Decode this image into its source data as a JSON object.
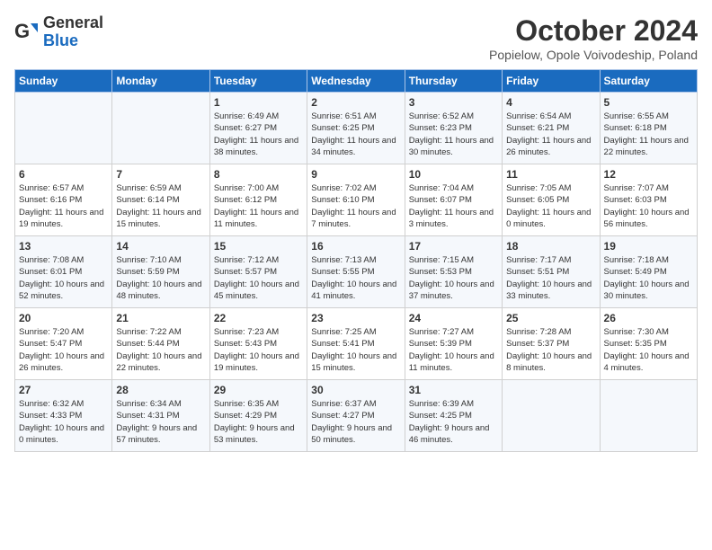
{
  "header": {
    "logo": {
      "general": "General",
      "blue": "Blue"
    },
    "title": "October 2024",
    "location": "Popielow, Opole Voivodeship, Poland"
  },
  "days_of_week": [
    "Sunday",
    "Monday",
    "Tuesday",
    "Wednesday",
    "Thursday",
    "Friday",
    "Saturday"
  ],
  "weeks": [
    [
      {
        "day": "",
        "info": ""
      },
      {
        "day": "",
        "info": ""
      },
      {
        "day": "1",
        "info": "Sunrise: 6:49 AM\nSunset: 6:27 PM\nDaylight: 11 hours\nand 38 minutes."
      },
      {
        "day": "2",
        "info": "Sunrise: 6:51 AM\nSunset: 6:25 PM\nDaylight: 11 hours\nand 34 minutes."
      },
      {
        "day": "3",
        "info": "Sunrise: 6:52 AM\nSunset: 6:23 PM\nDaylight: 11 hours\nand 30 minutes."
      },
      {
        "day": "4",
        "info": "Sunrise: 6:54 AM\nSunset: 6:21 PM\nDaylight: 11 hours\nand 26 minutes."
      },
      {
        "day": "5",
        "info": "Sunrise: 6:55 AM\nSunset: 6:18 PM\nDaylight: 11 hours\nand 22 minutes."
      }
    ],
    [
      {
        "day": "6",
        "info": "Sunrise: 6:57 AM\nSunset: 6:16 PM\nDaylight: 11 hours\nand 19 minutes."
      },
      {
        "day": "7",
        "info": "Sunrise: 6:59 AM\nSunset: 6:14 PM\nDaylight: 11 hours\nand 15 minutes."
      },
      {
        "day": "8",
        "info": "Sunrise: 7:00 AM\nSunset: 6:12 PM\nDaylight: 11 hours\nand 11 minutes."
      },
      {
        "day": "9",
        "info": "Sunrise: 7:02 AM\nSunset: 6:10 PM\nDaylight: 11 hours\nand 7 minutes."
      },
      {
        "day": "10",
        "info": "Sunrise: 7:04 AM\nSunset: 6:07 PM\nDaylight: 11 hours\nand 3 minutes."
      },
      {
        "day": "11",
        "info": "Sunrise: 7:05 AM\nSunset: 6:05 PM\nDaylight: 11 hours\nand 0 minutes."
      },
      {
        "day": "12",
        "info": "Sunrise: 7:07 AM\nSunset: 6:03 PM\nDaylight: 10 hours\nand 56 minutes."
      }
    ],
    [
      {
        "day": "13",
        "info": "Sunrise: 7:08 AM\nSunset: 6:01 PM\nDaylight: 10 hours\nand 52 minutes."
      },
      {
        "day": "14",
        "info": "Sunrise: 7:10 AM\nSunset: 5:59 PM\nDaylight: 10 hours\nand 48 minutes."
      },
      {
        "day": "15",
        "info": "Sunrise: 7:12 AM\nSunset: 5:57 PM\nDaylight: 10 hours\nand 45 minutes."
      },
      {
        "day": "16",
        "info": "Sunrise: 7:13 AM\nSunset: 5:55 PM\nDaylight: 10 hours\nand 41 minutes."
      },
      {
        "day": "17",
        "info": "Sunrise: 7:15 AM\nSunset: 5:53 PM\nDaylight: 10 hours\nand 37 minutes."
      },
      {
        "day": "18",
        "info": "Sunrise: 7:17 AM\nSunset: 5:51 PM\nDaylight: 10 hours\nand 33 minutes."
      },
      {
        "day": "19",
        "info": "Sunrise: 7:18 AM\nSunset: 5:49 PM\nDaylight: 10 hours\nand 30 minutes."
      }
    ],
    [
      {
        "day": "20",
        "info": "Sunrise: 7:20 AM\nSunset: 5:47 PM\nDaylight: 10 hours\nand 26 minutes."
      },
      {
        "day": "21",
        "info": "Sunrise: 7:22 AM\nSunset: 5:44 PM\nDaylight: 10 hours\nand 22 minutes."
      },
      {
        "day": "22",
        "info": "Sunrise: 7:23 AM\nSunset: 5:43 PM\nDaylight: 10 hours\nand 19 minutes."
      },
      {
        "day": "23",
        "info": "Sunrise: 7:25 AM\nSunset: 5:41 PM\nDaylight: 10 hours\nand 15 minutes."
      },
      {
        "day": "24",
        "info": "Sunrise: 7:27 AM\nSunset: 5:39 PM\nDaylight: 10 hours\nand 11 minutes."
      },
      {
        "day": "25",
        "info": "Sunrise: 7:28 AM\nSunset: 5:37 PM\nDaylight: 10 hours\nand 8 minutes."
      },
      {
        "day": "26",
        "info": "Sunrise: 7:30 AM\nSunset: 5:35 PM\nDaylight: 10 hours\nand 4 minutes."
      }
    ],
    [
      {
        "day": "27",
        "info": "Sunrise: 6:32 AM\nSunset: 4:33 PM\nDaylight: 10 hours\nand 0 minutes."
      },
      {
        "day": "28",
        "info": "Sunrise: 6:34 AM\nSunset: 4:31 PM\nDaylight: 9 hours\nand 57 minutes."
      },
      {
        "day": "29",
        "info": "Sunrise: 6:35 AM\nSunset: 4:29 PM\nDaylight: 9 hours\nand 53 minutes."
      },
      {
        "day": "30",
        "info": "Sunrise: 6:37 AM\nSunset: 4:27 PM\nDaylight: 9 hours\nand 50 minutes."
      },
      {
        "day": "31",
        "info": "Sunrise: 6:39 AM\nSunset: 4:25 PM\nDaylight: 9 hours\nand 46 minutes."
      },
      {
        "day": "",
        "info": ""
      },
      {
        "day": "",
        "info": ""
      }
    ]
  ]
}
